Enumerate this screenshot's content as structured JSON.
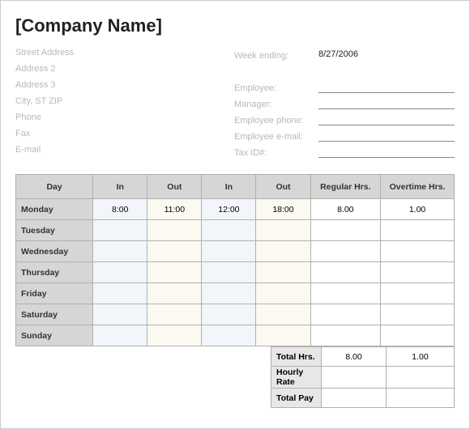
{
  "title": "[Company Name]",
  "left": {
    "street": "Street Address",
    "addr2": "Address 2",
    "addr3": "Address 3",
    "csz": "City, ST  ZIP",
    "phone": "Phone",
    "fax": "Fax",
    "email": "E-mail"
  },
  "right": {
    "week_ending_label": "Week ending:",
    "week_ending_value": "8/27/2006",
    "employee_label": "Employee:",
    "employee_value": "",
    "manager_label": "Manager:",
    "manager_value": "",
    "emp_phone_label": "Employee phone:",
    "emp_phone_value": "",
    "emp_email_label": "Employee e-mail:",
    "emp_email_value": "",
    "tax_label": "Tax ID#:",
    "tax_value": ""
  },
  "headers": {
    "day": "Day",
    "in": "In",
    "out": "Out",
    "in2": "In",
    "out2": "Out",
    "reg": "Regular Hrs.",
    "ot": "Overtime Hrs."
  },
  "rows": [
    {
      "day": "Monday",
      "in1": "8:00",
      "out1": "11:00",
      "in2": "12:00",
      "out2": "18:00",
      "reg": "8.00",
      "ot": "1.00"
    },
    {
      "day": "Tuesday",
      "in1": "",
      "out1": "",
      "in2": "",
      "out2": "",
      "reg": "",
      "ot": ""
    },
    {
      "day": "Wednesday",
      "in1": "",
      "out1": "",
      "in2": "",
      "out2": "",
      "reg": "",
      "ot": ""
    },
    {
      "day": "Thursday",
      "in1": "",
      "out1": "",
      "in2": "",
      "out2": "",
      "reg": "",
      "ot": ""
    },
    {
      "day": "Friday",
      "in1": "",
      "out1": "",
      "in2": "",
      "out2": "",
      "reg": "",
      "ot": ""
    },
    {
      "day": "Saturday",
      "in1": "",
      "out1": "",
      "in2": "",
      "out2": "",
      "reg": "",
      "ot": ""
    },
    {
      "day": "Sunday",
      "in1": "",
      "out1": "",
      "in2": "",
      "out2": "",
      "reg": "",
      "ot": ""
    }
  ],
  "totals": {
    "total_hrs_label": "Total Hrs.",
    "total_hrs_reg": "8.00",
    "total_hrs_ot": "1.00",
    "rate_label": "Hourly Rate",
    "rate_reg": "",
    "rate_ot": "",
    "pay_label": "Total Pay",
    "pay_reg": "",
    "pay_ot": ""
  }
}
